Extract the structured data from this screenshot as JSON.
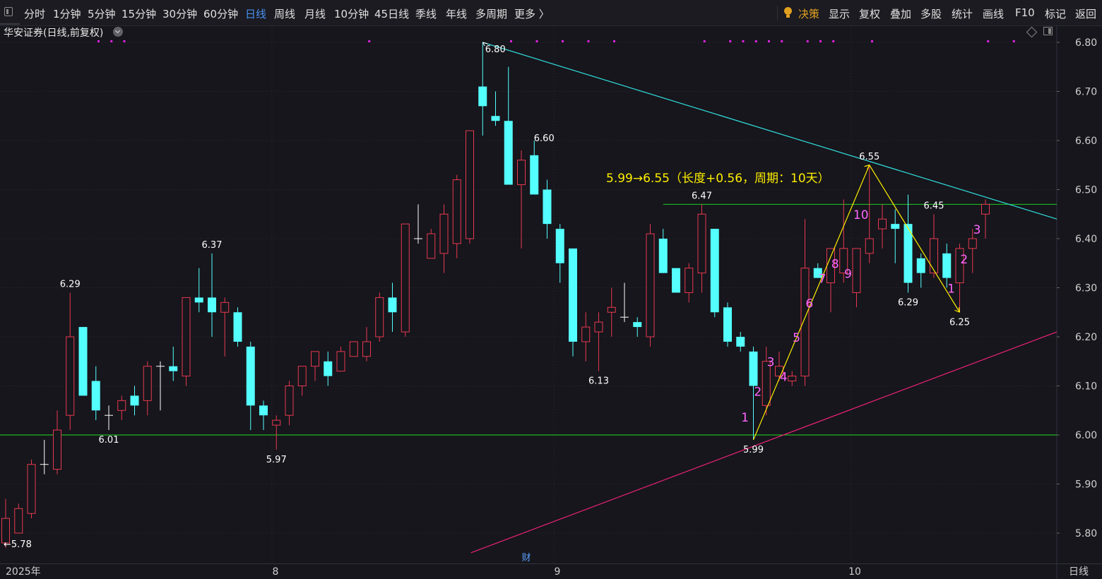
{
  "toolbar": {
    "periods": [
      "分时",
      "1分钟",
      "5分钟",
      "15分钟",
      "30分钟",
      "60分钟",
      "日线",
      "周线",
      "月线",
      "10分钟",
      "45日线",
      "季线",
      "年线",
      "多周期",
      "更多 〉"
    ],
    "active_period": "日线",
    "right_items": [
      "决策",
      "显示",
      "复权",
      "叠加",
      "多股",
      "统计",
      "画线",
      "F10",
      "标记",
      "返回"
    ],
    "decision_color": "#e0a020"
  },
  "stock_title": "华安证券(日线,前复权)",
  "axis": {
    "y_ticks": [
      "6.80",
      "6.70",
      "6.60",
      "6.50",
      "6.40",
      "6.30",
      "6.20",
      "6.10",
      "6.00",
      "5.90",
      "5.80"
    ],
    "x_labels": [
      "2025年",
      "8",
      "9",
      "10"
    ],
    "period_label": "日线"
  },
  "chart_data": {
    "type": "candlestick",
    "ylim": [
      5.76,
      6.82
    ],
    "up_color": "#e8384f",
    "down_color": "#54ffff",
    "doji_color": "#ffffff",
    "candles": [
      {
        "o": 5.78,
        "h": 5.87,
        "l": 5.77,
        "c": 5.83
      },
      {
        "o": 5.8,
        "h": 5.86,
        "l": 5.8,
        "c": 5.85
      },
      {
        "o": 5.84,
        "h": 5.95,
        "l": 5.83,
        "c": 5.94
      },
      {
        "o": 5.94,
        "h": 5.99,
        "l": 5.92,
        "c": 5.94
      },
      {
        "o": 5.93,
        "h": 6.05,
        "l": 5.92,
        "c": 6.01
      },
      {
        "o": 6.04,
        "h": 6.29,
        "l": 6.01,
        "c": 6.2
      },
      {
        "o": 6.22,
        "h": 6.22,
        "l": 6.08,
        "c": 6.08
      },
      {
        "o": 6.11,
        "h": 6.14,
        "l": 6.03,
        "c": 6.05
      },
      {
        "o": 6.04,
        "h": 6.06,
        "l": 6.01,
        "c": 6.04
      },
      {
        "o": 6.05,
        "h": 6.08,
        "l": 6.03,
        "c": 6.07
      },
      {
        "o": 6.08,
        "h": 6.1,
        "l": 6.04,
        "c": 6.06
      },
      {
        "o": 6.07,
        "h": 6.15,
        "l": 6.04,
        "c": 6.14
      },
      {
        "o": 6.14,
        "h": 6.15,
        "l": 6.05,
        "c": 6.14
      },
      {
        "o": 6.14,
        "h": 6.18,
        "l": 6.11,
        "c": 6.13
      },
      {
        "o": 6.12,
        "h": 6.28,
        "l": 6.1,
        "c": 6.28
      },
      {
        "o": 6.28,
        "h": 6.34,
        "l": 6.25,
        "c": 6.27
      },
      {
        "o": 6.28,
        "h": 6.37,
        "l": 6.2,
        "c": 6.25
      },
      {
        "o": 6.25,
        "h": 6.28,
        "l": 6.16,
        "c": 6.27
      },
      {
        "o": 6.25,
        "h": 6.26,
        "l": 6.18,
        "c": 6.19
      },
      {
        "o": 6.18,
        "h": 6.19,
        "l": 6.01,
        "c": 6.06
      },
      {
        "o": 6.06,
        "h": 6.07,
        "l": 6.01,
        "c": 6.04
      },
      {
        "o": 6.02,
        "h": 6.04,
        "l": 5.97,
        "c": 6.03
      },
      {
        "o": 6.04,
        "h": 6.11,
        "l": 6.02,
        "c": 6.1
      },
      {
        "o": 6.1,
        "h": 6.14,
        "l": 6.08,
        "c": 6.14
      },
      {
        "o": 6.14,
        "h": 6.17,
        "l": 6.11,
        "c": 6.17
      },
      {
        "o": 6.15,
        "h": 6.17,
        "l": 6.1,
        "c": 6.12
      },
      {
        "o": 6.13,
        "h": 6.18,
        "l": 6.13,
        "c": 6.17
      },
      {
        "o": 6.16,
        "h": 6.18,
        "l": 6.16,
        "c": 6.19
      },
      {
        "o": 6.16,
        "h": 6.22,
        "l": 6.15,
        "c": 6.19
      },
      {
        "o": 6.2,
        "h": 6.29,
        "l": 6.19,
        "c": 6.28
      },
      {
        "o": 6.28,
        "h": 6.31,
        "l": 6.21,
        "c": 6.25
      },
      {
        "o": 6.21,
        "h": 6.43,
        "l": 6.2,
        "c": 6.43
      },
      {
        "o": 6.4,
        "h": 6.47,
        "l": 6.39,
        "c": 6.4
      },
      {
        "o": 6.36,
        "h": 6.42,
        "l": 6.39,
        "c": 6.41
      },
      {
        "o": 6.37,
        "h": 6.47,
        "l": 6.33,
        "c": 6.45
      },
      {
        "o": 6.39,
        "h": 6.53,
        "l": 6.36,
        "c": 6.52
      },
      {
        "o": 6.4,
        "h": 6.62,
        "l": 6.39,
        "c": 6.62
      },
      {
        "o": 6.71,
        "h": 6.8,
        "l": 6.61,
        "c": 6.67
      },
      {
        "o": 6.65,
        "h": 6.7,
        "l": 6.63,
        "c": 6.64
      },
      {
        "o": 6.64,
        "h": 6.75,
        "l": 6.51,
        "c": 6.51
      },
      {
        "o": 6.51,
        "h": 6.58,
        "l": 6.38,
        "c": 6.56
      },
      {
        "o": 6.57,
        "h": 6.6,
        "l": 6.49,
        "c": 6.49
      },
      {
        "o": 6.5,
        "h": 6.52,
        "l": 6.4,
        "c": 6.43
      },
      {
        "o": 6.42,
        "h": 6.43,
        "l": 6.31,
        "c": 6.35
      },
      {
        "o": 6.38,
        "h": 6.38,
        "l": 6.16,
        "c": 6.19
      },
      {
        "o": 6.19,
        "h": 6.25,
        "l": 6.15,
        "c": 6.22
      },
      {
        "o": 6.21,
        "h": 6.25,
        "l": 6.13,
        "c": 6.23
      },
      {
        "o": 6.25,
        "h": 6.3,
        "l": 6.2,
        "c": 6.26
      },
      {
        "o": 6.24,
        "h": 6.31,
        "l": 6.23,
        "c": 6.24
      },
      {
        "o": 6.23,
        "h": 6.24,
        "l": 6.2,
        "c": 6.22
      },
      {
        "o": 6.2,
        "h": 6.43,
        "l": 6.18,
        "c": 6.41
      },
      {
        "o": 6.4,
        "h": 6.42,
        "l": 6.33,
        "c": 6.33
      },
      {
        "o": 6.34,
        "h": 6.34,
        "l": 6.29,
        "c": 6.29
      },
      {
        "o": 6.29,
        "h": 6.35,
        "l": 6.27,
        "c": 6.34
      },
      {
        "o": 6.33,
        "h": 6.47,
        "l": 6.29,
        "c": 6.45
      },
      {
        "o": 6.42,
        "h": 6.42,
        "l": 6.24,
        "c": 6.25
      },
      {
        "o": 6.26,
        "h": 6.27,
        "l": 6.18,
        "c": 6.19
      },
      {
        "o": 6.2,
        "h": 6.21,
        "l": 6.17,
        "c": 6.18
      },
      {
        "o": 6.17,
        "h": 6.18,
        "l": 5.99,
        "c": 6.1
      },
      {
        "o": 6.06,
        "h": 6.18,
        "l": 6.04,
        "c": 6.15
      },
      {
        "o": 6.12,
        "h": 6.17,
        "l": 6.11,
        "c": 6.14
      },
      {
        "o": 6.11,
        "h": 6.13,
        "l": 6.1,
        "c": 6.12
      },
      {
        "o": 6.12,
        "h": 6.44,
        "l": 6.1,
        "c": 6.34
      },
      {
        "o": 6.34,
        "h": 6.35,
        "l": 6.32,
        "c": 6.32
      },
      {
        "o": 6.31,
        "h": 6.38,
        "l": 6.25,
        "c": 6.38
      },
      {
        "o": 6.33,
        "h": 6.48,
        "l": 6.31,
        "c": 6.38
      },
      {
        "o": 6.29,
        "h": 6.38,
        "l": 6.26,
        "c": 6.38
      },
      {
        "o": 6.37,
        "h": 6.55,
        "l": 6.35,
        "c": 6.4
      },
      {
        "o": 6.42,
        "h": 6.47,
        "l": 6.38,
        "c": 6.44
      },
      {
        "o": 6.43,
        "h": 6.46,
        "l": 6.35,
        "c": 6.42
      },
      {
        "o": 6.43,
        "h": 6.49,
        "l": 6.29,
        "c": 6.31
      },
      {
        "o": 6.36,
        "h": 6.37,
        "l": 6.3,
        "c": 6.33
      },
      {
        "o": 6.33,
        "h": 6.45,
        "l": 6.32,
        "c": 6.4
      },
      {
        "o": 6.37,
        "h": 6.39,
        "l": 6.3,
        "c": 6.32
      },
      {
        "o": 6.31,
        "h": 6.39,
        "l": 6.25,
        "c": 6.38
      },
      {
        "o": 6.38,
        "h": 6.42,
        "l": 6.33,
        "c": 6.4
      },
      {
        "o": 6.45,
        "h": 6.48,
        "l": 6.4,
        "c": 6.47
      }
    ],
    "price_labels": [
      {
        "i": 0,
        "value": "←5.78",
        "pos": "low"
      },
      {
        "i": 5,
        "value": "6.29",
        "pos": "high"
      },
      {
        "i": 8,
        "value": "6.01",
        "pos": "low"
      },
      {
        "i": 16,
        "value": "6.37",
        "pos": "high"
      },
      {
        "i": 21,
        "value": "5.97",
        "pos": "low"
      },
      {
        "i": 37,
        "value": "6.80",
        "pos": "high"
      },
      {
        "i": 41,
        "value": "6.60",
        "pos": "high"
      },
      {
        "i": 46,
        "value": "6.13",
        "pos": "low"
      },
      {
        "i": 54,
        "value": "6.47",
        "pos": "high"
      },
      {
        "i": 58,
        "value": "5.99",
        "pos": "low"
      },
      {
        "i": 67,
        "value": "6.55",
        "pos": "high"
      },
      {
        "i": 70,
        "value": "6.29",
        "pos": "low"
      },
      {
        "i": 72,
        "value": "6.45",
        "pos": "high"
      },
      {
        "i": 74,
        "value": "6.25",
        "pos": "low"
      }
    ],
    "counts": [
      {
        "i": 58,
        "text": "1",
        "y": 5.04
      },
      {
        "i": 59,
        "text": "2",
        "y": 6.08
      },
      {
        "i": 60,
        "text": "3",
        "y": 6.14
      },
      {
        "i": 61,
        "text": "4",
        "y": 6.11
      },
      {
        "i": 62,
        "text": "5",
        "y": 6.19
      },
      {
        "i": 63,
        "text": "6",
        "y": 6.26
      },
      {
        "i": 64,
        "text": "7",
        "y": 6.31
      },
      {
        "i": 65,
        "text": "8",
        "y": 6.34
      },
      {
        "i": 66,
        "text": "9",
        "y": 6.32
      },
      {
        "i": 67,
        "text": "10",
        "y": 6.44
      },
      {
        "i": 74,
        "text": "1",
        "y": 6.29
      },
      {
        "i": 75,
        "text": "2",
        "y": 6.35
      },
      {
        "i": 76,
        "text": "3",
        "y": 6.41
      }
    ],
    "annotation": "5.99→6.55（长度+0.56，周期：10天）",
    "annotation_color": "#ffee00",
    "marker_caption": "财",
    "signal_dots": [
      4,
      5,
      6,
      25,
      36,
      38,
      40,
      42,
      44,
      51,
      53,
      54,
      55,
      56,
      57,
      59,
      60,
      61,
      64,
      73,
      75
    ],
    "resistance_level": 6.47,
    "support_level": 6.0,
    "trend_upper": {
      "start_i": 37,
      "start": 6.8,
      "end_i": 80,
      "end": 6.44
    },
    "trend_lower": {
      "start_i": 35,
      "start": 5.76,
      "end_i": 80,
      "end": 6.21
    },
    "colors": {
      "resistance": "#22cc22",
      "support": "#22dd22",
      "upper": "#33dddd",
      "lower": "#ee2277",
      "wave": "#ffee00",
      "count": "#ff66ff",
      "dots": "#e020e0"
    }
  }
}
